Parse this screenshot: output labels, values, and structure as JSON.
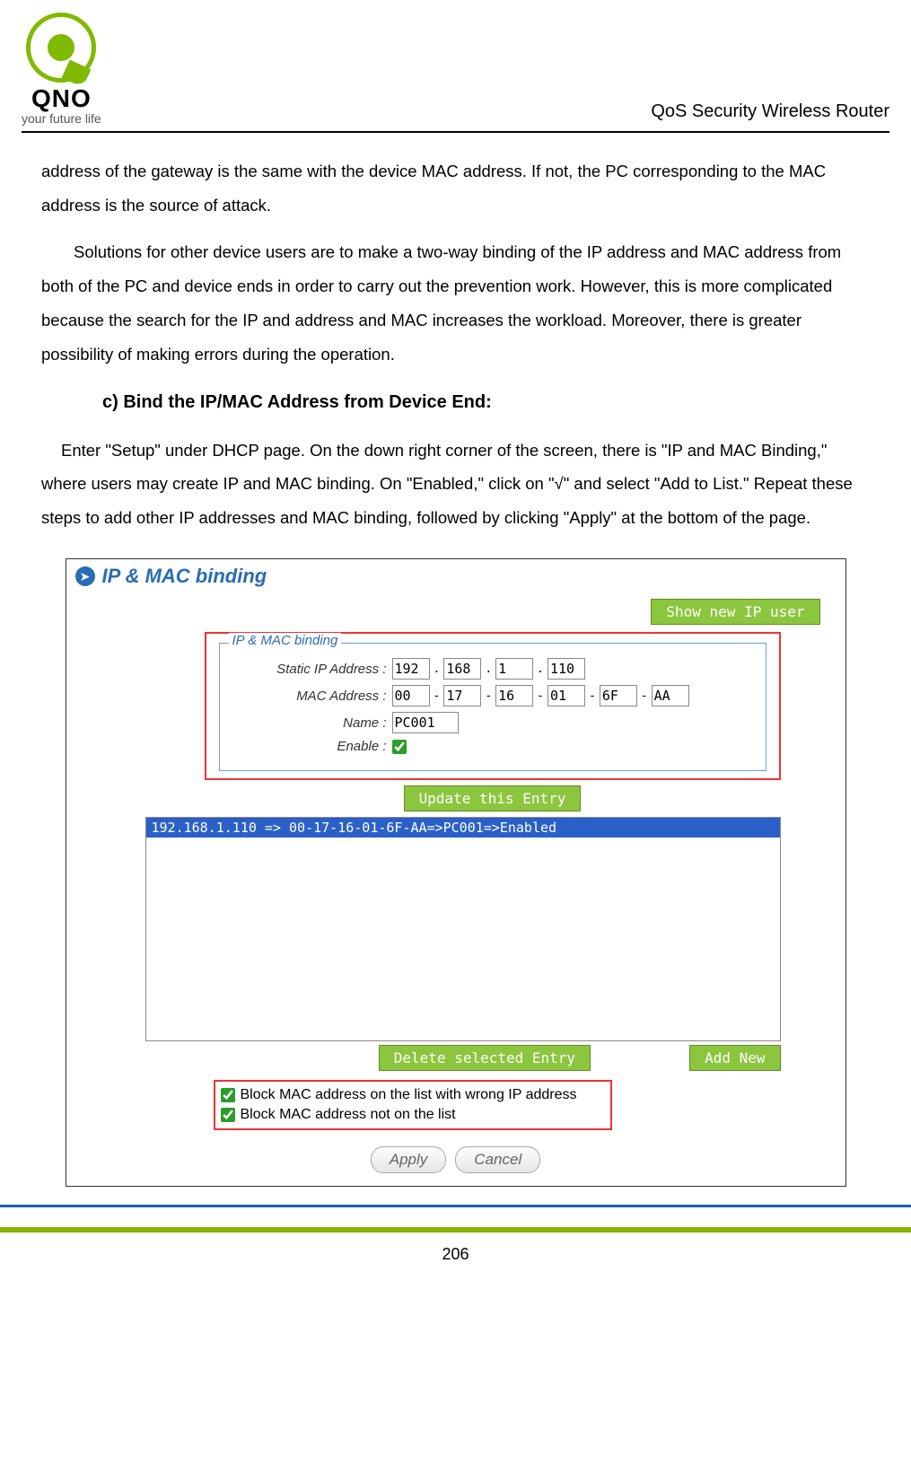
{
  "header": {
    "brand": "QNO",
    "tagline": "your future life",
    "right": "QoS Security Wireless Router"
  },
  "text": {
    "p1": "address of the gateway is the same with the device MAC address. If not, the PC corresponding to the MAC address is the source of attack.",
    "p2": "Solutions for other device users are to make a two-way binding of the IP address and MAC address from both of the PC and device ends in order to carry out the prevention work. However, this is more complicated because the search for the IP and address and MAC increases the workload. Moreover, there is greater possibility of making errors during the operation.",
    "sub_c": "c) Bind the IP/MAC Address from Device End:",
    "p3": "Enter \"Setup\" under DHCP page. On the down right corner of the screen, there is \"IP and MAC Binding,\" where users may create IP and MAC binding. On \"Enabled,\" click on \"√\" and select \"Add to List.\" Repeat these steps to add other IP addresses and MAC binding, followed by clicking \"Apply\" at the bottom of the page."
  },
  "app": {
    "section_title": "IP & MAC binding",
    "show_new_ip": "Show new IP user",
    "fieldset_title": "IP & MAC binding",
    "labels": {
      "static_ip": "Static IP Address :",
      "mac": "MAC Address :",
      "name": "Name :",
      "enable": "Enable :"
    },
    "ip": {
      "a": "192",
      "b": "168",
      "c": "1",
      "d": "110"
    },
    "mac": {
      "a": "00",
      "b": "17",
      "c": "16",
      "d": "01",
      "e": "6F",
      "f": "AA"
    },
    "name_value": "PC001",
    "update_btn": "Update this Entry",
    "list_entry": "192.168.1.110 => 00-17-16-01-6F-AA=>PC001=>Enabled",
    "delete_btn": "Delete selected Entry",
    "add_new_btn": "Add New",
    "block1": "Block MAC address on the list with wrong IP address",
    "block2": "Block MAC address not on the list",
    "apply": "Apply",
    "cancel": "Cancel"
  },
  "pagenum": "206"
}
